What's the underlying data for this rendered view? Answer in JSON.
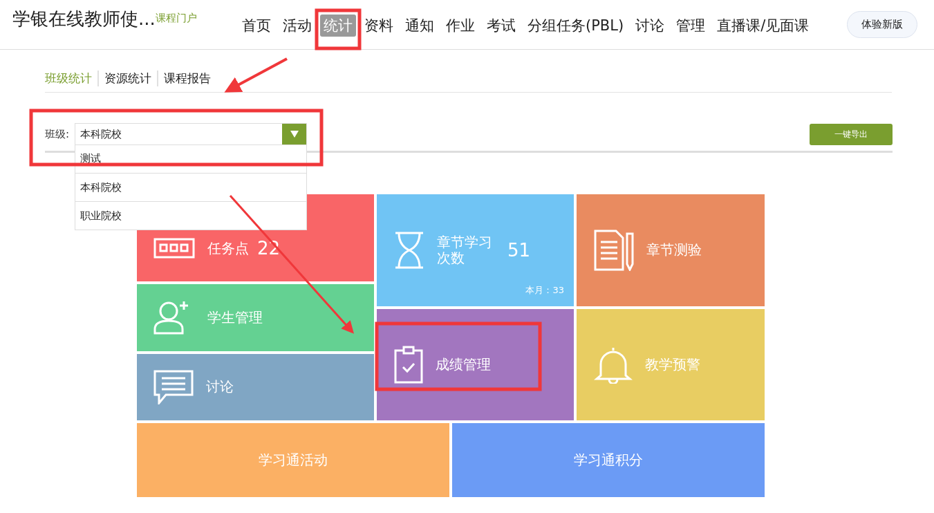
{
  "header": {
    "title": "学银在线教师使...",
    "portal_link": "课程门户",
    "nav": [
      {
        "label": "首页",
        "selected": false
      },
      {
        "label": "活动",
        "selected": false
      },
      {
        "label": "统计",
        "selected": true
      },
      {
        "label": "资料",
        "selected": false
      },
      {
        "label": "通知",
        "selected": false
      },
      {
        "label": "作业",
        "selected": false
      },
      {
        "label": "考试",
        "selected": false
      },
      {
        "label": "分组任务(PBL)",
        "selected": false
      },
      {
        "label": "讨论",
        "selected": false
      },
      {
        "label": "管理",
        "selected": false
      },
      {
        "label": "直播课/见面课",
        "selected": false
      }
    ],
    "new_version_button": "体验新版"
  },
  "sub_tabs": [
    {
      "label": "班级统计",
      "selected": true
    },
    {
      "label": "资源统计",
      "selected": false
    },
    {
      "label": "课程报告",
      "selected": false
    }
  ],
  "class_filter": {
    "label": "班级:",
    "value": "本科院校",
    "expanded": true,
    "options": [
      "测试",
      "本科院校",
      "职业院校"
    ]
  },
  "export_button": "一键导出",
  "tile_columns": [
    [
      {
        "kind": "tasks",
        "label": "任务点",
        "value": "22",
        "color": "#f96567"
      },
      {
        "kind": "student",
        "label": "学生管理",
        "color": "#64d192"
      },
      {
        "kind": "discussion",
        "label": "讨论",
        "color": "#80a6c4"
      }
    ],
    [
      {
        "kind": "hourglass",
        "label": "章节学习次数",
        "value": "51",
        "note": "本月：33",
        "color": "#70c4f4"
      },
      {
        "kind": "grade",
        "label": "成绩管理",
        "color": "#a276bf"
      }
    ],
    [
      {
        "kind": "quiz",
        "label": "章节测验",
        "color": "#e98b60"
      },
      {
        "kind": "bell",
        "label": "教学预警",
        "color": "#e8cd62"
      }
    ]
  ],
  "bottom_tiles": [
    {
      "label": "学习通活动",
      "color": "#fbb064"
    },
    {
      "label": "学习通积分",
      "color": "#6b9bf5"
    }
  ]
}
